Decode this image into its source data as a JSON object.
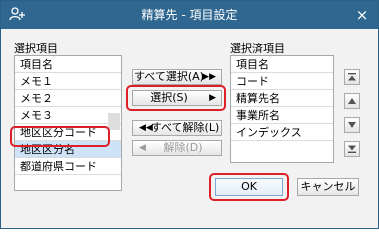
{
  "window": {
    "title": "精算先 - 項目設定",
    "close_glyph": "×"
  },
  "left_panel": {
    "label": "選択項目",
    "header": "項目名",
    "items": [
      "メモ１",
      "メモ２",
      "メモ３",
      "地区区分コード",
      "地区区分名",
      "都道府県コード"
    ],
    "selected_item": "地区区分名"
  },
  "right_panel": {
    "label": "選択済項目",
    "header": "項目名",
    "items": [
      "コード",
      "精算先名",
      "事業所名",
      "インデックス"
    ]
  },
  "buttons": {
    "select_all": "すべて選択(A)",
    "select": "選択(S)",
    "deselect_all": "すべて解除(L)",
    "deselect": "解除(D)",
    "ok": "OK",
    "cancel": "キャンセル"
  },
  "icons": {
    "title": "person-search-icon",
    "move_top": "move-to-top-icon",
    "move_up": "move-up-icon",
    "move_down": "move-down-icon",
    "move_bottom": "move-to-bottom-icon"
  },
  "colors": {
    "titlebar": "#2f6790",
    "highlight": "#dd1f2a",
    "selected_row": "#cfe3f8"
  }
}
